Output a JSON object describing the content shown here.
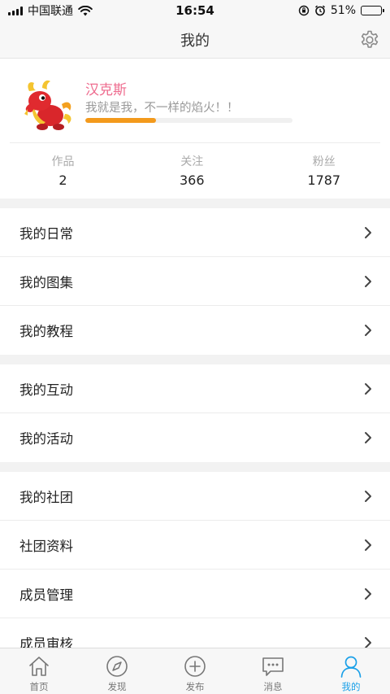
{
  "status_bar": {
    "carrier": "中国联通",
    "time": "16:54",
    "battery": "51%",
    "battery_level": 0.51
  },
  "nav": {
    "title": "我的",
    "settings_icon": "gear-icon"
  },
  "profile": {
    "nickname": "汉克斯",
    "bio": "我就是我，不一样的焰火！！",
    "level_progress": 0.34,
    "stats": [
      {
        "label": "作品",
        "value": "2"
      },
      {
        "label": "关注",
        "value": "366"
      },
      {
        "label": "粉丝",
        "value": "1787"
      }
    ]
  },
  "menu_groups": [
    {
      "items": [
        {
          "label": "我的日常"
        },
        {
          "label": "我的图集"
        },
        {
          "label": "我的教程"
        }
      ]
    },
    {
      "items": [
        {
          "label": "我的互动"
        },
        {
          "label": "我的活动"
        }
      ]
    },
    {
      "items": [
        {
          "label": "我的社团"
        },
        {
          "label": "社团资料"
        },
        {
          "label": "成员管理"
        },
        {
          "label": "成员审核"
        }
      ]
    }
  ],
  "tabs": [
    {
      "label": "首页",
      "icon": "home-icon"
    },
    {
      "label": "发现",
      "icon": "compass-icon"
    },
    {
      "label": "发布",
      "icon": "plus-circle-icon"
    },
    {
      "label": "消息",
      "icon": "message-icon"
    },
    {
      "label": "我的",
      "icon": "person-icon",
      "active": true
    }
  ],
  "colors": {
    "accent": "#1aa0e8",
    "nickname": "#ee6b8e",
    "progress": "#f39a1c"
  }
}
